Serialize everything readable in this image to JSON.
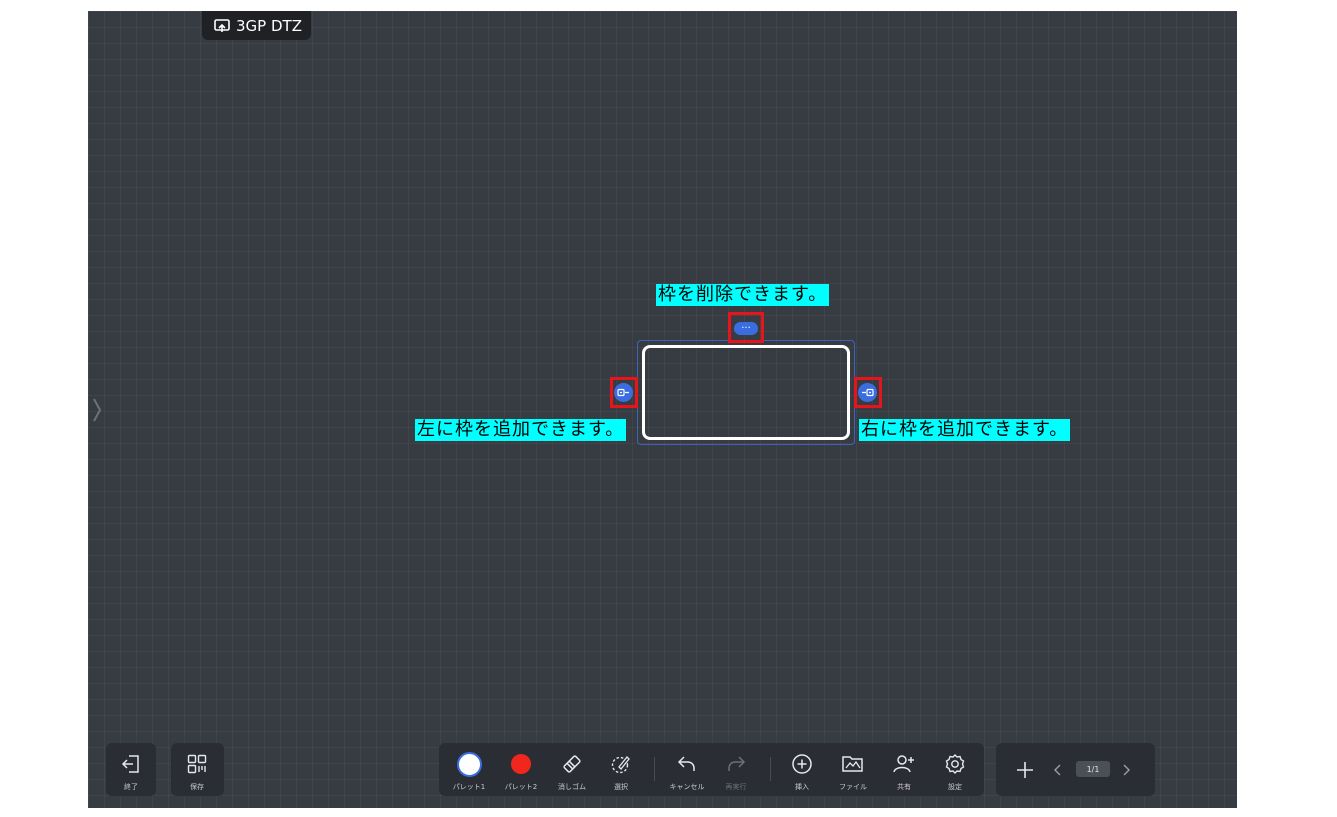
{
  "room": {
    "icon": "cast-icon",
    "name": "3GP DTZ"
  },
  "annotations": {
    "delete": "枠を削除できます。",
    "add_left": "左に枠を追加できます。",
    "add_right": "右に枠を追加できます。"
  },
  "frame_controls": {
    "more_icon": "more-dots-icon",
    "add_left_icon": "add-frame-left-icon",
    "add_right_icon": "add-frame-right-icon"
  },
  "colors": {
    "canvas": "#373b42",
    "highlight": "#00ffff",
    "marker": "#e8141c",
    "accent": "#3a6ee0",
    "palette2": "#f1271d"
  },
  "left_toolbar": {
    "exit_label": "終了",
    "save_label": "保存"
  },
  "main_toolbar": {
    "palette1_label": "パレット1",
    "palette2_label": "パレット2",
    "eraser_label": "消しゴム",
    "select_label": "選択",
    "undo_label": "キャンセル",
    "redo_label": "再実行",
    "insert_label": "挿入",
    "file_label": "ファイル",
    "share_label": "共有",
    "settings_label": "設定"
  },
  "page_nav": {
    "indicator": "1/1"
  }
}
